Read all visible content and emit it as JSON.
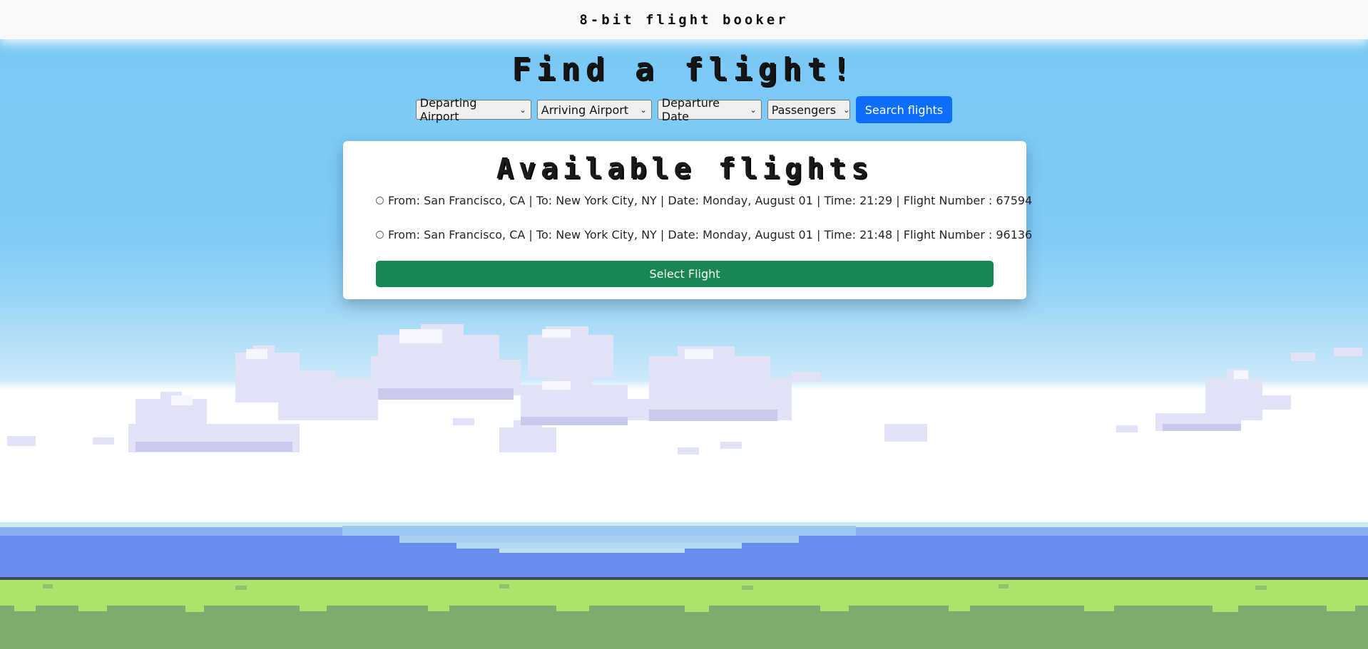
{
  "header": {
    "brand": "8-bit flight booker"
  },
  "hero": {
    "title": "Find a flight!"
  },
  "search": {
    "departing_label": "Departing Airport",
    "arriving_label": "Arriving Airport",
    "date_label": "Departure Date",
    "passengers_label": "Passengers",
    "button_label": "Search flights"
  },
  "results": {
    "title": "Available flights",
    "flights": [
      {
        "label": "From: San Francisco, CA | To: New York City, NY | Date: Monday, August 01 | Time: 21:29 | Flight Number : 67594"
      },
      {
        "label": "From: San Francisco, CA | To: New York City, NY | Date: Monday, August 01 | Time: 21:48 | Flight Number : 96136"
      }
    ],
    "select_button": "Select Flight"
  },
  "colors": {
    "primary": "#0d6efd",
    "success": "#198754",
    "sky": "#7ecbf6",
    "water": "#6a8ef0",
    "grass": "#a9e06a"
  }
}
